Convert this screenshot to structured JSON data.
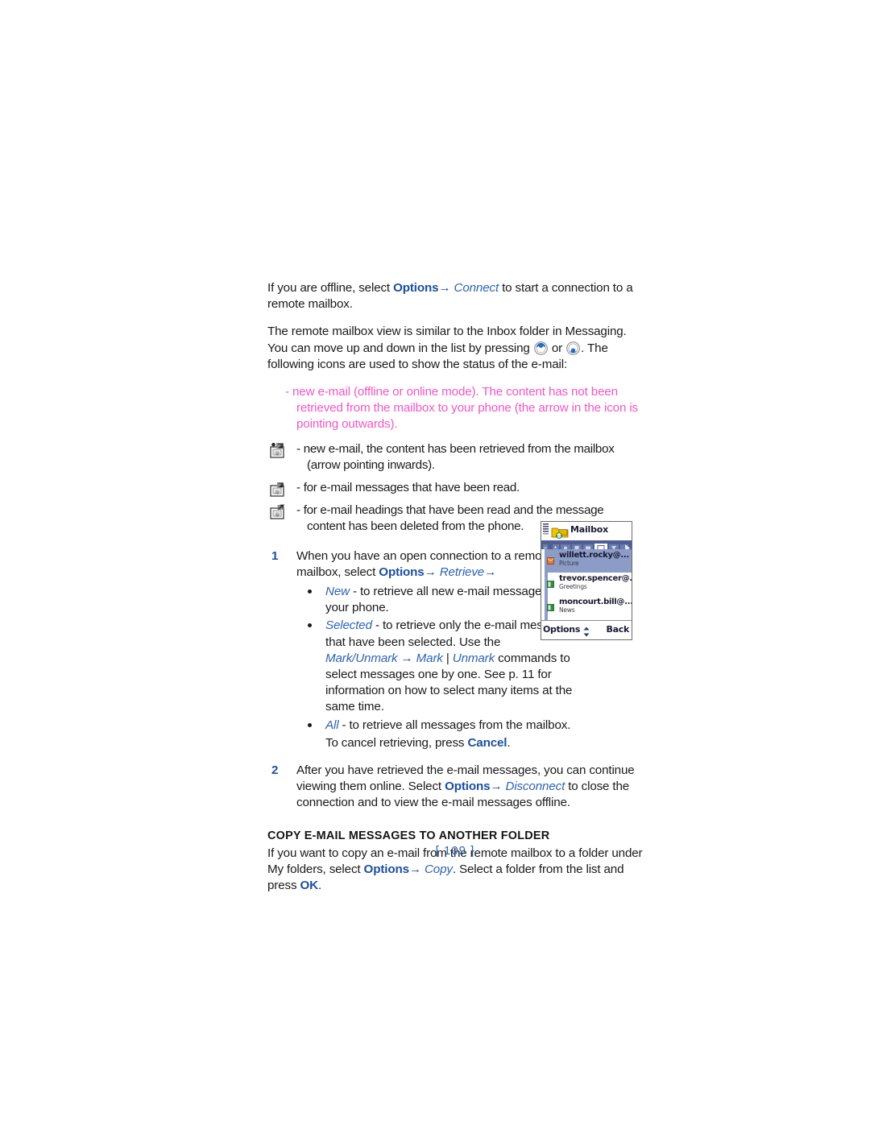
{
  "document": {
    "page_number": "[ 109 ]"
  },
  "paragraphs": {
    "p1": {
      "lead": "If you are offline, select ",
      "bold1": "Options",
      "arrow1": "→",
      "ital1": " Connect",
      "tail": " to start a connection to a remote mailbox."
    },
    "p2": {
      "part1": "The remote mailbox view is similar to the Inbox folder in Messaging. You can move up and down in the list by pressing ",
      "mid": " or ",
      "part2": ". The following icons are used to show the status of the e-mail:"
    }
  },
  "status_icons": [
    {
      "icon": "new-email-not-retrieved-icon",
      "dash": "-",
      "text": "new e-mail (offline or online mode). The content has not been retrieved from the mailbox to your phone (the arrow in the icon is pointing outwards).",
      "color": "#f254c8"
    },
    {
      "icon": "new-email-retrieved-icon",
      "dash": "-",
      "text": "new e-mail, the content has been retrieved from the mailbox (arrow pointing inwards)."
    },
    {
      "icon": "email-read-icon",
      "dash": "-",
      "text": "for e-mail messages that have been read."
    },
    {
      "icon": "email-heading-deleted-icon",
      "dash": "-",
      "text": "for e-mail headings that have been read and the message content has been deleted from the phone."
    }
  ],
  "steps": [
    {
      "number": "1",
      "lead": "When you have an open connection to a remote mailbox, select ",
      "bold1": "Options",
      "arrow1": "→",
      "ital1": " Retrieve",
      "arrow2": "→"
    },
    {
      "number": "2",
      "lead": "After you have retrieved the e-mail messages, you can continue viewing them online. Select ",
      "bold1": "Options",
      "arrow1": "→",
      "ital1": " Disconnect",
      "tail": " to close the connection and to view the e-mail messages offline."
    }
  ],
  "bullets": [
    {
      "ital": "New",
      "text": " - to retrieve all new e-mail messages to your phone."
    },
    {
      "ital": "Selected",
      "text_a": " - to retrieve only the e-mail messages that have been selected. Use the ",
      "ital_b": "Mark/Unmark",
      "arrow": " → ",
      "ital_c": "Mark",
      "sep": " | ",
      "ital_d": "Unmark",
      "text_b": " commands to select messages one by one. See p. 11 for information on how to select many items at the same time."
    },
    {
      "ital": "All",
      "text": " - to retrieve all messages from the mailbox."
    }
  ],
  "cancel_line": {
    "lead": "To cancel retrieving, press ",
    "bold": "Cancel",
    "tail": "."
  },
  "section": {
    "heading": "COPY E-MAIL MESSAGES TO ANOTHER FOLDER",
    "lead": "If you want to copy an e-mail from the remote mailbox to a folder under My folders, select ",
    "bold1": "Options",
    "arrow1": "→",
    "ital1": " Copy",
    "mid": ". Select a folder from the list and press ",
    "bold2": "OK",
    "tail": "."
  },
  "phone_screenshot": {
    "title": "Mailbox",
    "messages": [
      {
        "sender": "willett.rocky@...",
        "subject": "Picture",
        "attachment": "ॱ",
        "selected": true,
        "status": "unread-orange"
      },
      {
        "sender": "trevor.spencer@...",
        "subject": "Greetings",
        "attachment": "ॱ",
        "selected": false,
        "status": "read-green"
      },
      {
        "sender": "moncourt.bill@...",
        "subject": "News",
        "attachment": "",
        "selected": false,
        "status": "read-green"
      }
    ],
    "softkey_left": "Options",
    "softkey_right": "Back"
  },
  "colors": {
    "heading_blue": "#1b4f9c",
    "italic_blue": "#2e63b0",
    "note_magenta": "#f254c8",
    "phone_selection": "#8c9cc6",
    "phone_tabbar": "#4f5f96"
  }
}
